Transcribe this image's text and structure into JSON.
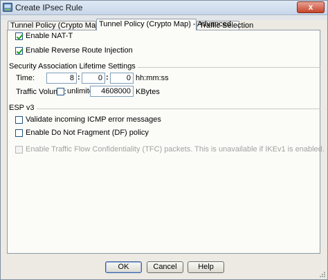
{
  "window": {
    "title": "Create IPsec Rule",
    "close_label": "x"
  },
  "tabs": [
    {
      "label": "Tunnel Policy (Crypto Map) - Basic",
      "active": false
    },
    {
      "label": "Tunnel Policy (Crypto Map) - Advanced",
      "active": true
    },
    {
      "label": "Traffic Selection",
      "active": false
    }
  ],
  "options": {
    "nat_t": {
      "label": "Enable NAT-T",
      "checked": true
    },
    "rri": {
      "label": "Enable Reverse Route Injection",
      "checked": true
    }
  },
  "sa_lifetime": {
    "group_label": "Security Association Lifetime Settings",
    "time_label": "Time:",
    "hours": "8",
    "minutes": "0",
    "seconds": "0",
    "time_format": "hh:mm:ss",
    "traffic_label": "Traffic Volume:",
    "unlimited_label": "unlimited",
    "unlimited_checked": false,
    "traffic_value": "4608000",
    "traffic_unit": "KBytes"
  },
  "esp": {
    "group_label": "ESP v3",
    "validate_icmp": {
      "label": "Validate incoming ICMP error messages",
      "checked": false
    },
    "dont_fragment": {
      "label": "Enable Do Not Fragment (DF)  policy",
      "checked": false
    },
    "tfc": {
      "label": "Enable Traffic Flow Confidentiality (TFC) packets. This is unavailable if IKEv1 is enabled.",
      "checked": false,
      "disabled": true
    }
  },
  "buttons": {
    "ok": "OK",
    "cancel": "Cancel",
    "help": "Help"
  },
  "colors": {
    "window_bg": "#eceae2",
    "panel_bg": "#fbfbf8",
    "check_green": "#21a121",
    "close_red": "#c7452b"
  }
}
